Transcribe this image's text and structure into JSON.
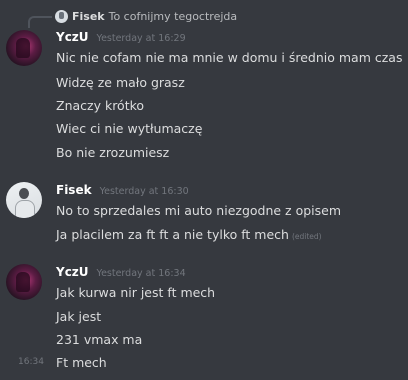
{
  "reply": {
    "author": "Fisek",
    "text": "To cofnijmy tegoctrejda"
  },
  "groups": [
    {
      "author": "YczU",
      "timestamp": "Yesterday at 16:29",
      "lines": [
        "Nic nie cofam nie ma mnie w domu i średnio mam czas",
        "Widzę ze mało grasz",
        "Znaczy krótko",
        "Wiec ci nie wytłumaczę",
        "Bo nie zrozumiesz"
      ]
    },
    {
      "author": "Fisek",
      "timestamp": "Yesterday at 16:30",
      "lines": [
        "No to sprzedales mi auto niezgodne z opisem",
        "Ja placilem za ft ft a nie tylko ft mech"
      ],
      "edited_label": "(edited)"
    },
    {
      "author": "YczU",
      "timestamp": "Yesterday at 16:34",
      "lines": [
        "Jak kurwa nir jest ft mech",
        "Jak jest",
        "231 vmax ma",
        "Ft mech"
      ],
      "hover_time": "16:34"
    }
  ],
  "colors": {
    "background": "#36393f",
    "username": "#ffffff",
    "message_text": "#dcddde",
    "timestamp": "#72767d"
  }
}
